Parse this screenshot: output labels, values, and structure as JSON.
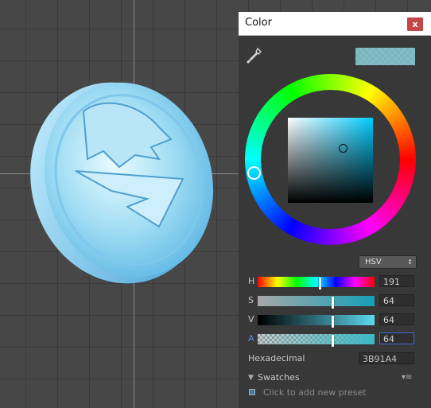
{
  "window": {
    "title": "Color",
    "close_label": "x"
  },
  "picker": {
    "mode": "HSV",
    "sliders": [
      {
        "key": "H",
        "label": "H",
        "value": "191",
        "fraction": 0.53
      },
      {
        "key": "S",
        "label": "S",
        "value": "64",
        "fraction": 0.64
      },
      {
        "key": "V",
        "label": "V",
        "value": "64",
        "fraction": 0.64
      },
      {
        "key": "A",
        "label": "A",
        "value": "64",
        "fraction": 0.64
      }
    ],
    "hex_label": "Hexadecimal",
    "hex_value": "3B91A4"
  },
  "swatches": {
    "label": "Swatches",
    "add_preset": "Click to add new preset"
  },
  "icons": {
    "eyedropper": "eyedropper-icon",
    "close": "close-icon",
    "mode_arrow": "updown-arrows-icon",
    "swatch_menu": "menu-icon",
    "swatch_toggle": "triangle-down-icon"
  },
  "colors": {
    "current": "#3B91A4",
    "active_label": "#5f8bea",
    "close_button": "#c44848"
  }
}
